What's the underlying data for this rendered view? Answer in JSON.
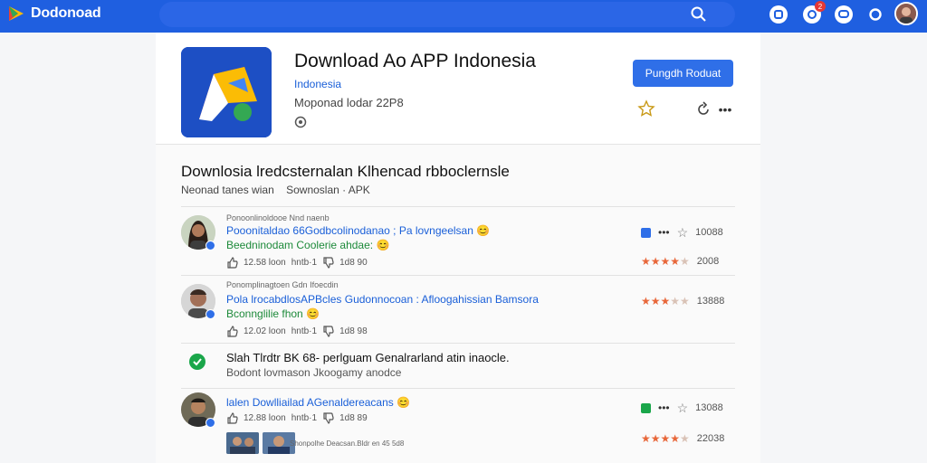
{
  "topbar": {
    "brand_name": "Dodonoad",
    "notification_count": "2",
    "accent": "#1f5fe0"
  },
  "app": {
    "title": "Download Ao APP Indonesia",
    "developer": "Indonesia",
    "meta": "Moponad lodar 22P8",
    "install_label": "Pungdh Roduat",
    "icon_bg": "#1d4fc4"
  },
  "section": {
    "title": "Downlosia lredcsternalan Klhencad rbboclernsle",
    "sub_left": "Neonad tanes wian",
    "sub_right": "Sownoslan · APK"
  },
  "reviews": [
    {
      "meta": "Ponoonlinoldooe Nnd naenb",
      "line1": "Pooonitaldao 66Godbcolinodanao ; Pa lovngeelsan 😊",
      "line2": "Beedninodam Coolerie ahdae: 😊",
      "likes": "12.58 loon",
      "dislikes": "1d8 90",
      "reply": "hntb·1",
      "icon_label": "",
      "count": "10088",
      "rating": 4.5,
      "rating_count": "2008"
    },
    {
      "meta": "Ponomplinagtoen Gdn Ifoecdin",
      "line1": "Pola lrocabdlosAPBcles Gudonnocoan : Afloogahissian Bamsora",
      "line2": "Bconnglilie  fhon 😊",
      "likes": "12.02 loon",
      "dislikes": "1d8 98",
      "reply": "hntb·1",
      "rating": 3.5,
      "rating_count": "13888"
    },
    {
      "meta": "",
      "line1": "lalen Dowlliailad AGenaldereacans 😊",
      "likes": "12.88 loon",
      "dislikes": "1d8 89",
      "reply": "hntb·1",
      "count": "13088",
      "rating": 4.5,
      "rating_count": "22038",
      "caption": "Shonpolhe Deacsan.Bldr en 45 5d8"
    }
  ],
  "note": {
    "main": "Slah Tlrdtr BK 68- perlguam Genalrarland atin inaocle.",
    "sub": "Bodont lovmason Jkoogamy anodce"
  }
}
